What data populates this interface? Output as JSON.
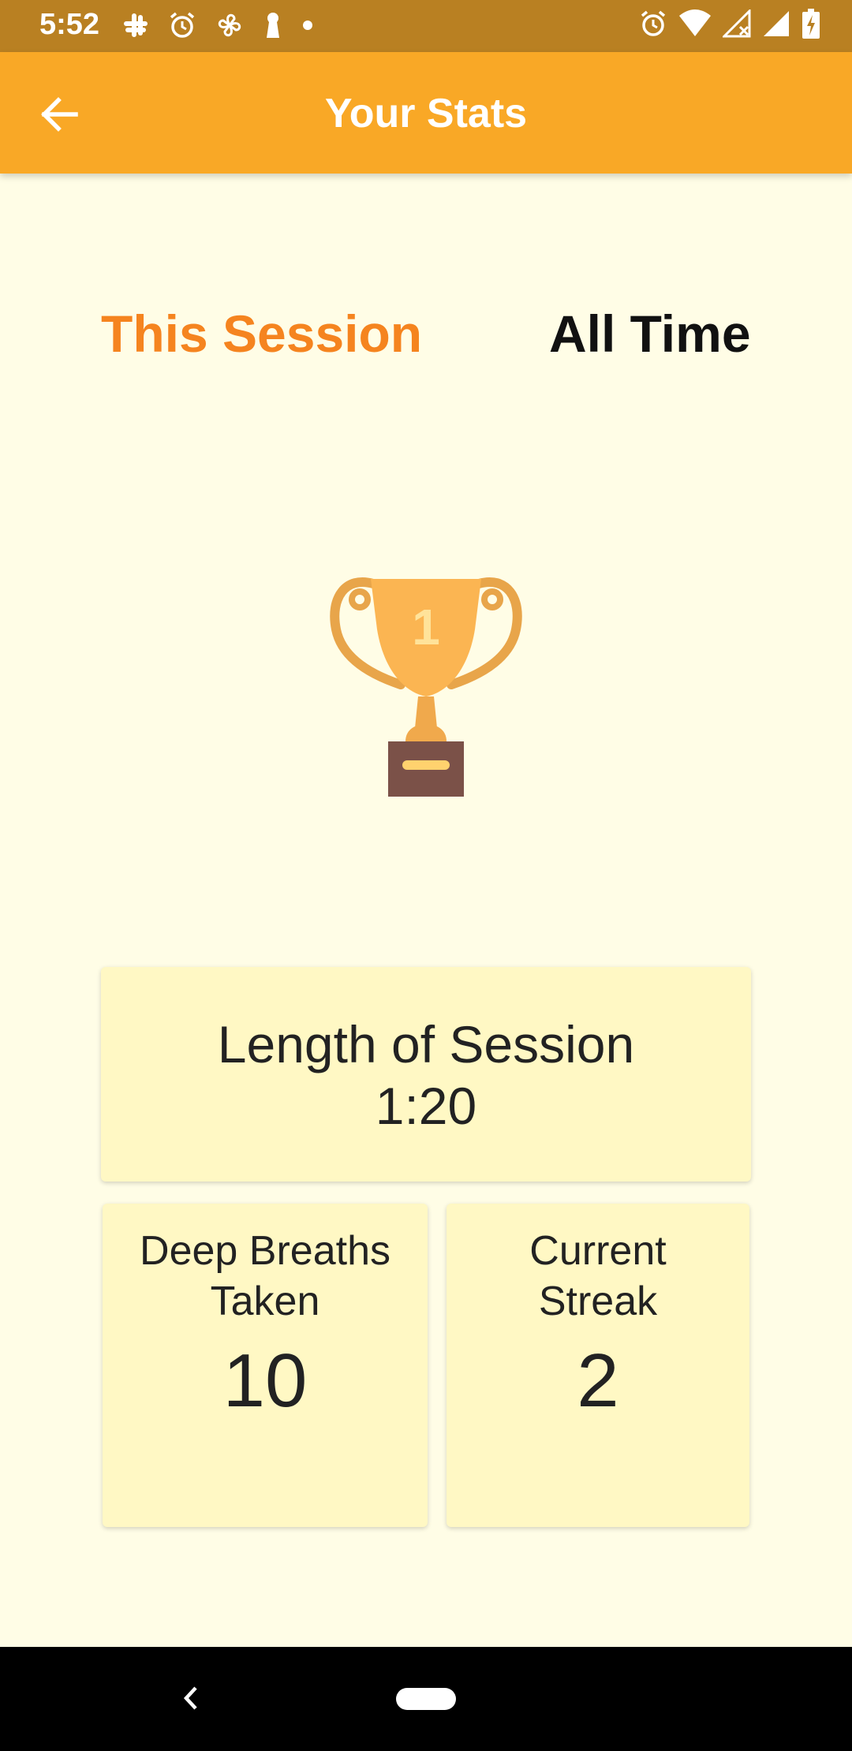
{
  "status_bar": {
    "time": "5:52",
    "left_icons": [
      "slack-icon",
      "alarm-icon",
      "pinwheel-icon",
      "keyhole-icon",
      "dot-icon"
    ],
    "right_icons": [
      "alarm-icon",
      "wifi-icon",
      "signal-no-data-icon",
      "signal-icon",
      "battery-charging-icon"
    ]
  },
  "app_bar": {
    "title": "Your Stats",
    "color": "#f9a826"
  },
  "tabs": [
    {
      "label": "This Session",
      "selected": true,
      "color": "#f5841f"
    },
    {
      "label": "All Time",
      "selected": false,
      "color": "#111111"
    }
  ],
  "trophy": {
    "icon": "trophy-icon",
    "rank": "1"
  },
  "stats": {
    "length": {
      "label": "Length of Session",
      "value": "1:20"
    },
    "breaths": {
      "label_line1": "Deep Breaths",
      "label_line2": "Taken",
      "value": "10"
    },
    "streak": {
      "label_line1": "Current",
      "label_line2": "Streak",
      "value": "2"
    }
  },
  "colors": {
    "background": "#fffde6",
    "card": "#fff8c4",
    "status_bar": "#b98022"
  }
}
